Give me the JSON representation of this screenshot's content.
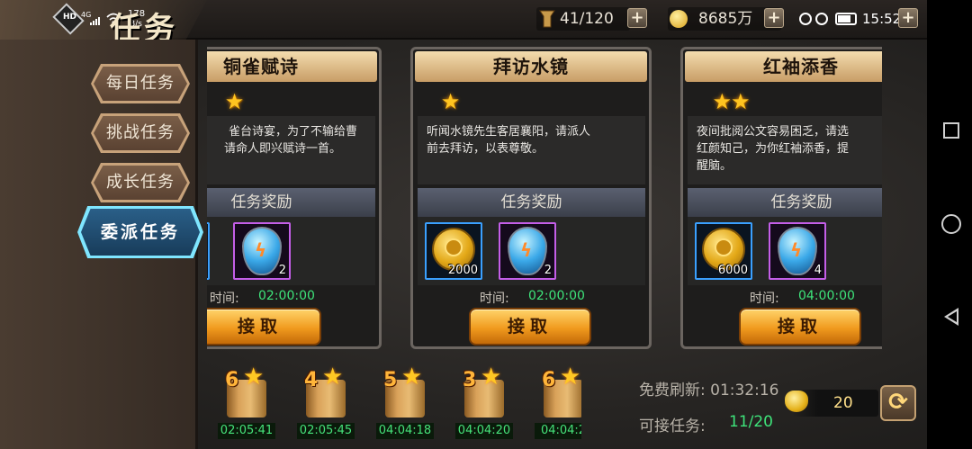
{
  "status_bar": {
    "network": "4G",
    "speed_value": "178",
    "speed_unit": "B/s",
    "clock": "15:52",
    "hd_label": "HD"
  },
  "header": {
    "title": "任务"
  },
  "resources": {
    "stamina": "41/120",
    "coins": "8685万"
  },
  "sidebar": {
    "tabs": [
      {
        "label": "每日任务",
        "active": false
      },
      {
        "label": "挑战任务",
        "active": false
      },
      {
        "label": "成长任务",
        "active": false
      },
      {
        "label": "委派任务",
        "active": true
      }
    ]
  },
  "cards": [
    {
      "title": "铜雀赋诗",
      "stars": "★",
      "desc_line1": "雀台诗宴，为了不输给曹",
      "desc_line2": "请命人即兴赋诗一首。",
      "reward_header": "任务奖励",
      "reward_count": "2",
      "time_label": "时间:",
      "time_value": "02:00:00",
      "accept": "接取"
    },
    {
      "title": "拜访水镜",
      "stars": "★",
      "desc_line1": "听闻水镜先生客居襄阳，请派人",
      "desc_line2": "前去拜访，以表尊敬。",
      "reward_header": "任务奖励",
      "coin_count": "2000",
      "reward_count": "2",
      "time_label": "时间:",
      "time_value": "02:00:00",
      "accept": "接取"
    },
    {
      "title": "红袖添香",
      "stars": "★★",
      "desc_line1": "夜间批阅公文容易困乏，请选",
      "desc_line2": "红颜知己，为你红袖添香，提",
      "desc_line3": "醒脑。",
      "reward_header": "任务奖励",
      "coin_count": "6000",
      "reward_count": "4",
      "time_label": "时间:",
      "time_value": "04:00:00",
      "accept": "接取"
    }
  ],
  "scrolls": [
    {
      "level": "6",
      "timer": "02:05:41"
    },
    {
      "level": "4",
      "timer": "02:05:45"
    },
    {
      "level": "5",
      "timer": "04:04:18"
    },
    {
      "level": "3",
      "timer": "04:04:20"
    },
    {
      "level": "6",
      "timer": "04:04:2"
    }
  ],
  "footer": {
    "refresh_label": "免费刷新: 01:32:16",
    "available_label": "可接任务:",
    "available_value": "11/20",
    "gold_value": "20"
  },
  "icons": {
    "star": "star-icon",
    "coin": "coin-icon",
    "gem": "gem-icon",
    "refresh": "refresh-icon"
  }
}
